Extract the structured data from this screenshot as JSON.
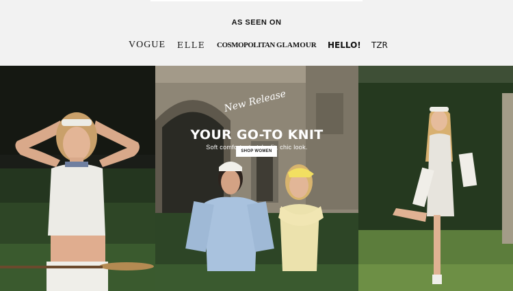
{
  "press": {
    "title": "AS SEEN ON",
    "logos": [
      "VOGUE",
      "ELLE",
      "COSMOPOLITAN",
      "GLAMOUR",
      "HELLO!",
      "TZR"
    ]
  },
  "hero": {
    "script_text": "New Release",
    "headline": "YOUR GO-TO KNIT",
    "subhead": "Soft comfort, stretchy fit, chic look.",
    "cta_label": "SHOP WOMEN",
    "colors": {
      "cta_bg": "#ffffff",
      "hedge": "#2f4a28",
      "knit_blue": "#a9c2de",
      "knit_yellow": "#ece2ad"
    }
  }
}
